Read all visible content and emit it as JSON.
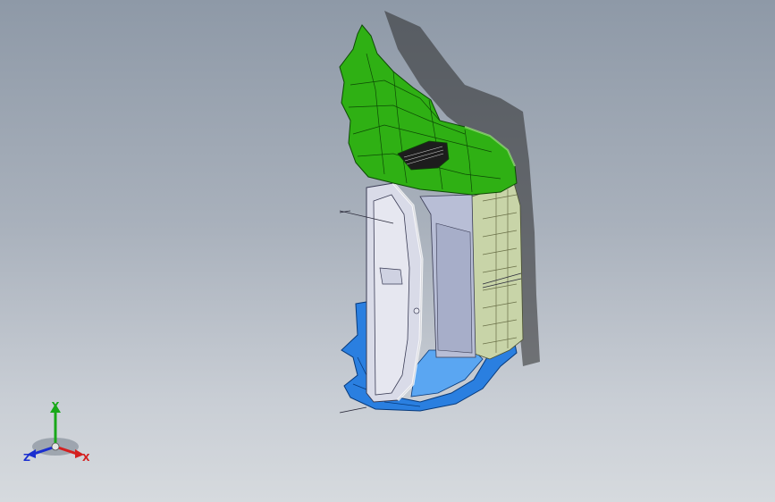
{
  "viewport": {
    "background_top": "#8e99a7",
    "background_bottom": "#d6dade"
  },
  "model": {
    "colors": {
      "top_shell": "#2fb014",
      "top_shell_edge": "#0d4a05",
      "door_panel": "#d9dbe8",
      "door_edge": "#3a3c55",
      "inner_wall": "#b8bed6",
      "side_rib": "#c8d4a8",
      "base": "#2a7fe0",
      "base_edge": "#083a7a",
      "shadow": "#2a2a2a"
    }
  },
  "triad": {
    "x_label": "X",
    "y_label": "Y",
    "z_label": "Z",
    "x_color": "#d42020",
    "y_color": "#18a818",
    "z_color": "#1a2fd0"
  }
}
